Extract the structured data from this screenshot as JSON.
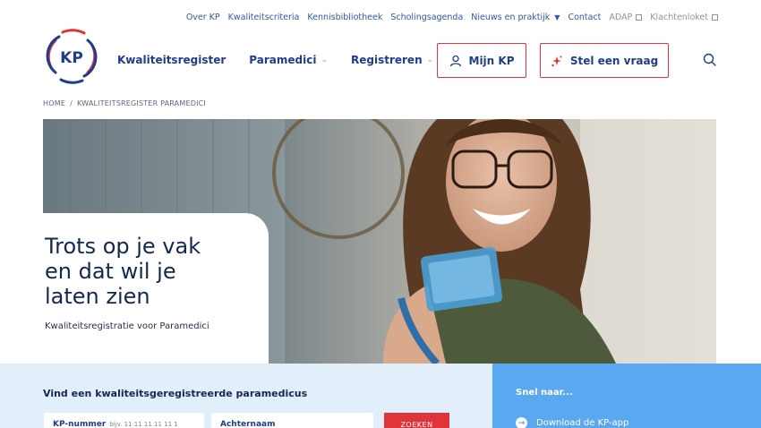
{
  "topnav": {
    "items": [
      {
        "label": "Over KP"
      },
      {
        "label": "Kwaliteitscriteria"
      },
      {
        "label": "Kennisbibliotheek"
      },
      {
        "label": "Scholingsagenda"
      },
      {
        "label": "Nieuws en praktijk"
      },
      {
        "label": "Contact"
      },
      {
        "label": "ADAP"
      },
      {
        "label": "Klachtenloket"
      }
    ]
  },
  "logo": {
    "text": "KP"
  },
  "mainnav": {
    "items": [
      {
        "label": "Kwaliteitsregister"
      },
      {
        "label": "Paramedici"
      },
      {
        "label": "Registreren"
      }
    ]
  },
  "buttons": {
    "mijn_kp": "Mijn KP",
    "stel_vraag": "Stel een vraag"
  },
  "breadcrumb": {
    "home": "HOME",
    "separator": "/",
    "current": "KWALITEITSREGISTER PARAMEDICI"
  },
  "hero": {
    "title_line1": "Trots op je vak",
    "title_line2": "en dat wil je",
    "title_line3": "laten zien",
    "subtitle": "Kwaliteitsregistratie voor Paramedici"
  },
  "search": {
    "title": "Vind een kwaliteitsgeregistreerde paramedicus",
    "kp_label": "KP-nummer",
    "kp_hint": "bijv. 11 11 11 11 11 1",
    "naam_label": "Achternaam",
    "submit": "ZOEKEN"
  },
  "snel": {
    "title": "Snel naar...",
    "items": [
      {
        "label": "Download de KP-app"
      }
    ]
  },
  "colors": {
    "brand_blue": "#1f3d8a",
    "accent_red": "#e1343a",
    "light_band": "#e3eefb",
    "snel_band": "#5aa9f0"
  }
}
